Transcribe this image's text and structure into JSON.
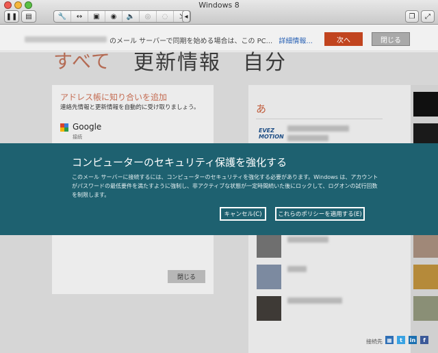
{
  "window": {
    "title": "Windows 8"
  },
  "colors": {
    "traffic_close": "#ee5a52",
    "traffic_min": "#f5b73b",
    "traffic_max": "#59c043",
    "accent_orange": "#c1441f",
    "dialog_teal": "#1e6170"
  },
  "toolbar": {
    "icons": [
      "pause-icon",
      "settings-icon",
      "wrench-icon",
      "arrows-icon",
      "fit-icon",
      "lock-icon",
      "speaker-icon",
      "camera-icon",
      "mouse-icon",
      "resize-icon",
      "collapse-icon",
      "window-icon",
      "fullscreen-icon"
    ]
  },
  "notification": {
    "text": "のメール サーバーで同期を始める場合は、この PC...",
    "link": "詳細情報...",
    "next_label": "次へ",
    "close_label": "閉じる"
  },
  "header": {
    "accent": "すべて",
    "main": "更新情報　自分"
  },
  "left_card": {
    "title": "アドレス帳に知り合いを追加",
    "subtitle": "連絡先情報と更新情報を自動的に受け取りましょう。",
    "service_name": "Google",
    "service_status": "接続",
    "close_label": "閉じる"
  },
  "right_panel": {
    "section_letter": "あ",
    "evez_logo": "EVEZ\nMOTION",
    "footer_label": "接続先"
  },
  "dialog": {
    "title": "コンピューターのセキュリティ保護を強化する",
    "body": "このメール サーバーに接続するには、コンピューターのセキュリティを強化する必要があります。Windows は、アカウントがパスワードの最低要件を満たすように強制し、非アクティブな状態が一定時間続いた後にロックして、ログオンの試行回数を制限します。",
    "cancel_label": "キャンセル(C)",
    "apply_label": "これらのポリシーを適用する(E)"
  }
}
